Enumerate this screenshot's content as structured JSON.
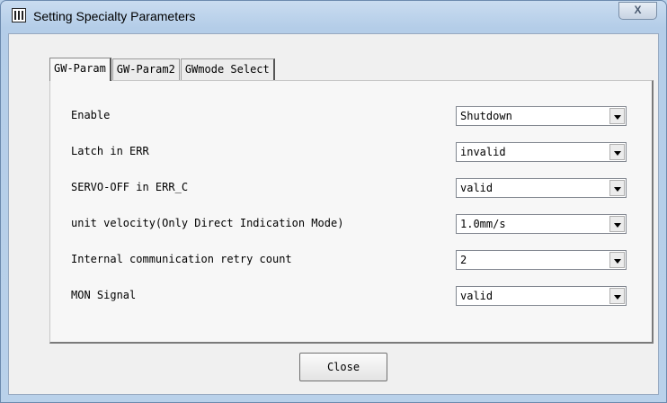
{
  "window": {
    "title": "Setting Specialty Parameters",
    "close_glyph": "X"
  },
  "tabs": [
    {
      "label": "GW-Param",
      "active": true
    },
    {
      "label": "GW-Param2",
      "active": false
    },
    {
      "label": "GWmode Select",
      "active": false
    }
  ],
  "params": [
    {
      "label": "Enable",
      "value": "Shutdown"
    },
    {
      "label": "Latch in ERR",
      "value": "invalid"
    },
    {
      "label": "SERVO-OFF in ERR_C",
      "value": "valid"
    },
    {
      "label": "unit velocity(Only Direct Indication Mode)",
      "value": "1.0mm/s"
    },
    {
      "label": "Internal communication retry count",
      "value": "2"
    },
    {
      "label": "MON Signal",
      "value": "valid"
    }
  ],
  "buttons": {
    "close_label": "Close"
  },
  "colors": {
    "title_bar": "#b9d1ea",
    "dialog_bg": "#f0f0f0",
    "panel_bg": "#f7f7f7"
  }
}
